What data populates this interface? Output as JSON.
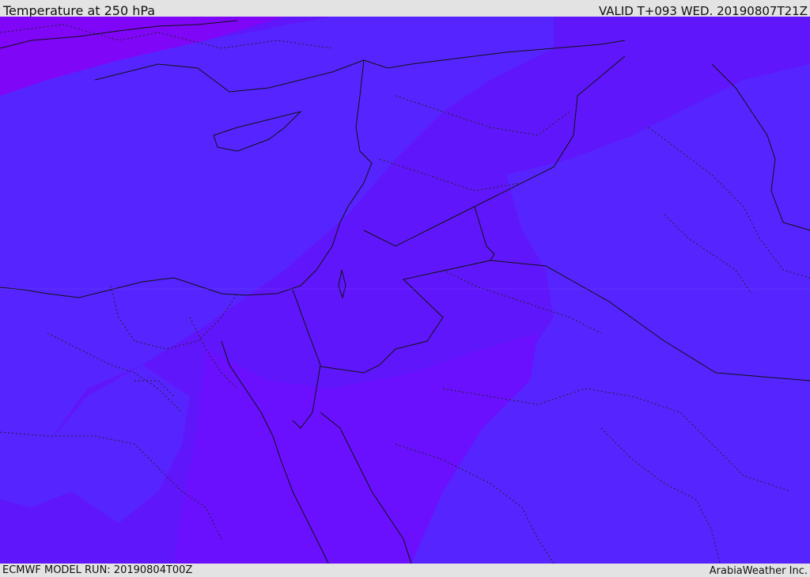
{
  "header": {
    "title": "Temperature at 250 hPa",
    "valid": "VALID T+093 WED. 20190807T21Z"
  },
  "footer": {
    "model_run": "ECMWF MODEL RUN: 20190804T00Z",
    "credit": "ArabiaWeather Inc."
  },
  "colors": {
    "base": "#6016fb",
    "cool_band": "#5624ff",
    "warm_zone": "#6a10fe",
    "northwest_corner": "#8006f8",
    "coast": "#111111"
  }
}
